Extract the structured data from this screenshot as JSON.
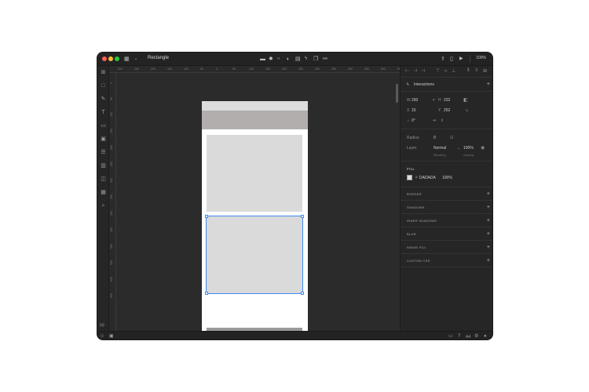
{
  "window": {
    "title": "Rectangle",
    "zoom": "100%"
  },
  "rulers": {
    "top": [
      "-300",
      "-250",
      "-200",
      "-150",
      "-100",
      "-50",
      "0",
      "50",
      "100",
      "150",
      "200",
      "250",
      "300",
      "350",
      "400",
      "450",
      "500",
      "550"
    ],
    "left": [
      "0",
      "50",
      "100",
      "150",
      "200",
      "250",
      "300",
      "350",
      "400",
      "450",
      "500",
      "550",
      "600",
      "650"
    ]
  },
  "inspector": {
    "interactions_label": "Interactions",
    "w_label": "W",
    "w_value": "290",
    "h_label": "H",
    "h_value": "232",
    "x_label": "X",
    "x_value": "15",
    "y_label": "Y",
    "y_value": "252",
    "angle_value": "0°",
    "radius_label": "Radius",
    "radius_value": "0",
    "layer_label": "Layer",
    "blending_value": "Normal",
    "opacity_value": "100%",
    "blending_sub": "Blending",
    "opacity_sub": "Opacity",
    "fill_label": "FILL",
    "fill_hex": "DADADA",
    "fill_opacity": "100%",
    "fill_color": "#DADADA",
    "sections": [
      "BORDER",
      "SHADOWS",
      "INNER SHADOWS",
      "BLUR",
      "IMAGE FILL",
      "CUSTOM CSS"
    ]
  },
  "statusbar": {
    "page_label": "A4"
  },
  "colors": {
    "selection": "#3d8bf5",
    "header_fill": "#b2aeae",
    "rect_fill": "#dadada"
  }
}
